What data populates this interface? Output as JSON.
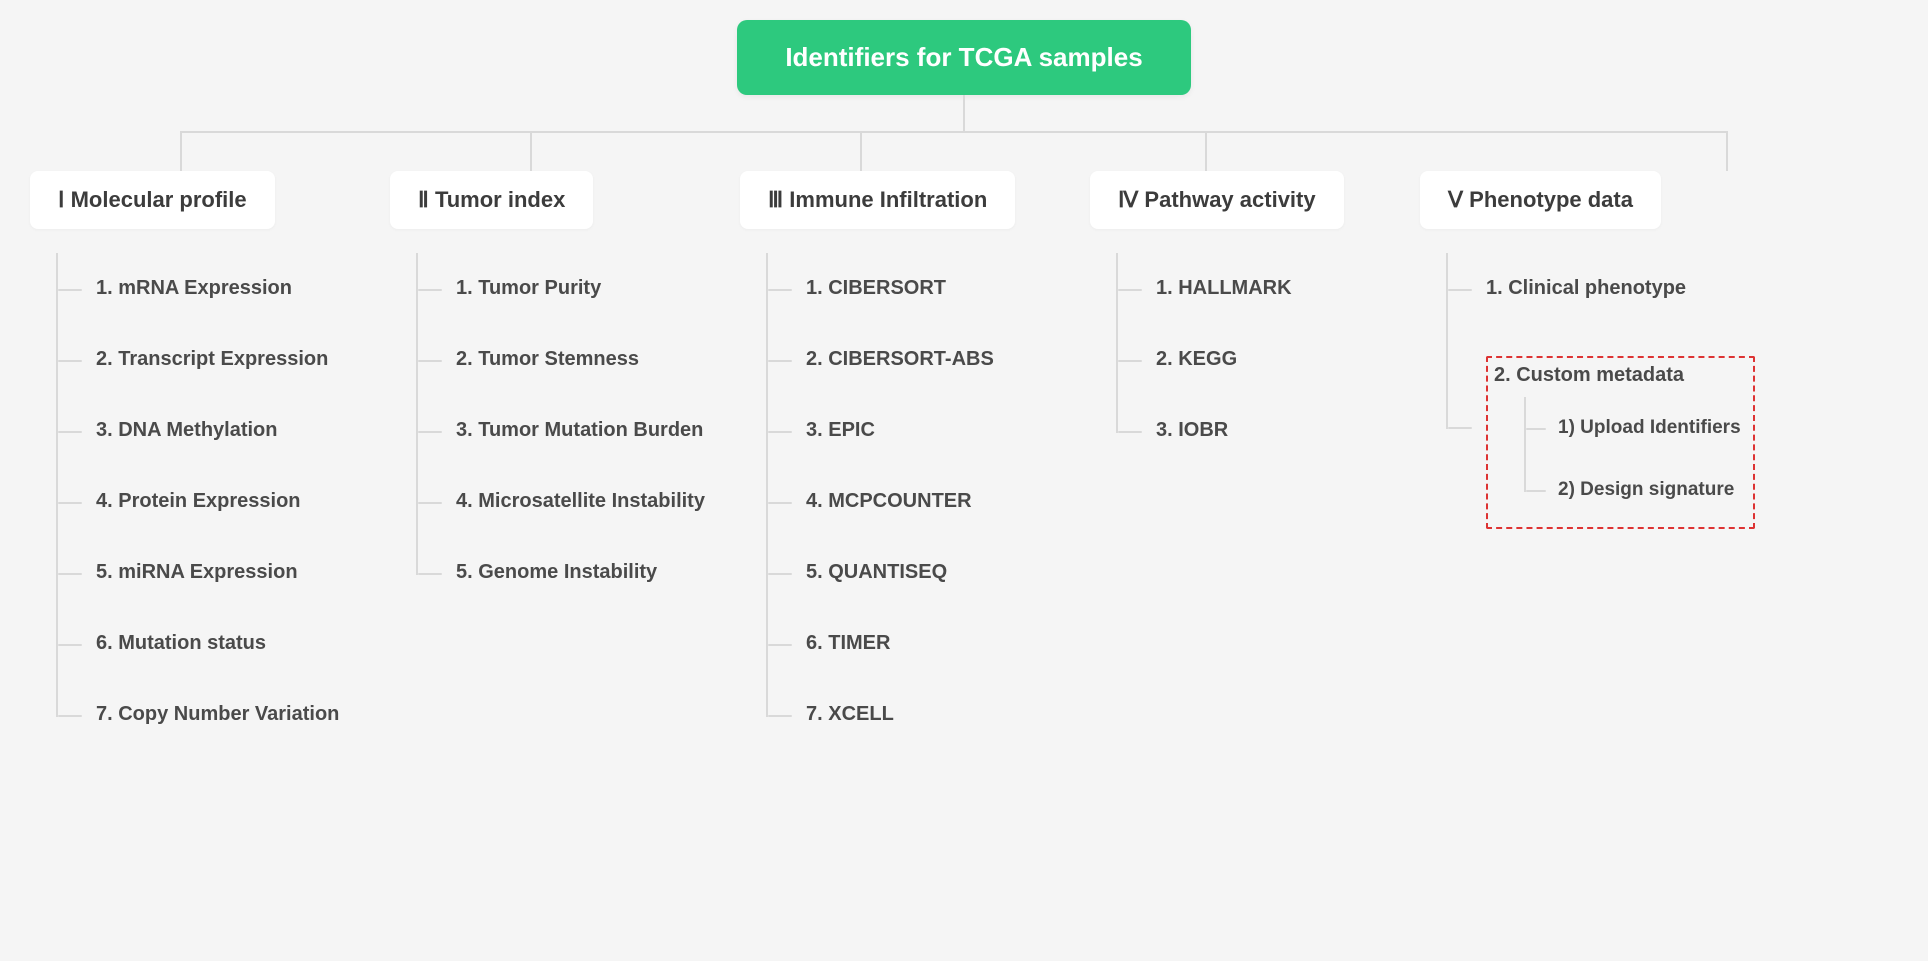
{
  "root": {
    "title": "Identifiers for TCGA samples"
  },
  "categories": [
    {
      "label": "Ⅰ Molecular profile",
      "items": [
        {
          "label": "1. mRNA Expression"
        },
        {
          "label": "2. Transcript Expression"
        },
        {
          "label": "3. DNA Methylation"
        },
        {
          "label": "4. Protein Expression"
        },
        {
          "label": "5. miRNA Expression"
        },
        {
          "label": "6. Mutation status"
        },
        {
          "label": "7. Copy Number Variation"
        }
      ]
    },
    {
      "label": "Ⅱ Tumor index",
      "items": [
        {
          "label": "1. Tumor Purity"
        },
        {
          "label": "2. Tumor Stemness"
        },
        {
          "label": "3. Tumor Mutation Burden"
        },
        {
          "label": "4. Microsatellite Instability"
        },
        {
          "label": "5. Genome Instability"
        }
      ]
    },
    {
      "label": "Ⅲ Immune Infiltration",
      "items": [
        {
          "label": "1. CIBERSORT"
        },
        {
          "label": "2. CIBERSORT-ABS"
        },
        {
          "label": "3. EPIC"
        },
        {
          "label": "4. MCPCOUNTER"
        },
        {
          "label": "5. QUANTISEQ"
        },
        {
          "label": "6. TIMER"
        },
        {
          "label": "7. XCELL"
        }
      ]
    },
    {
      "label": "Ⅳ Pathway activity",
      "items": [
        {
          "label": "1. HALLMARK"
        },
        {
          "label": "2. KEGG"
        },
        {
          "label": "3. IOBR"
        }
      ]
    },
    {
      "label": "Ⅴ Phenotype data",
      "items": [
        {
          "label": "1. Clinical phenotype"
        },
        {
          "label": "2. Custom metadata",
          "highlight": true,
          "children": [
            {
              "label": "1) Upload Identifiers"
            },
            {
              "label": "2) Design signature"
            }
          ]
        }
      ]
    }
  ],
  "colors": {
    "root_bg": "#2dc97e",
    "root_fg": "#ffffff",
    "node_bg": "#ffffff",
    "text": "#3c3c3c",
    "connector": "#d9d9d9",
    "highlight_border": "#d33"
  }
}
